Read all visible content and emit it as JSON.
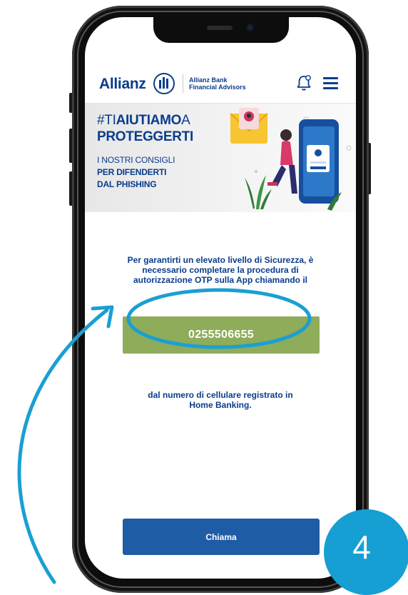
{
  "header": {
    "brand": "Allianz",
    "brand_sub_line1": "Allianz Bank",
    "brand_sub_line2": "Financial Advisors"
  },
  "banner": {
    "title_prefix": "#TI",
    "title_bold": "AIUTIAMO",
    "title_suffix": "A",
    "title_line2": "PROTEGGERTI",
    "line1": "I NOSTRI CONSIGLI",
    "line2": "PER DIFENDERTI",
    "line3": "DAL PHISHING"
  },
  "content": {
    "intro": "Per garantirti un elevato livello di Sicurezza, è necessario completare la procedura di autorizzazione OTP sulla App chiamando il",
    "phone_number": "0255506655",
    "sub_line1": "dal numero di cellulare registrato in",
    "sub_line2": "Home Banking.",
    "call_label": "Chiama"
  },
  "annotation": {
    "step_number": "4",
    "highlight_color": "#1a9fd4"
  },
  "colors": {
    "brand_blue": "#0a3c8c",
    "phone_button": "#8eac5a",
    "call_button": "#1f5ca6",
    "step_badge": "#159fd3"
  }
}
